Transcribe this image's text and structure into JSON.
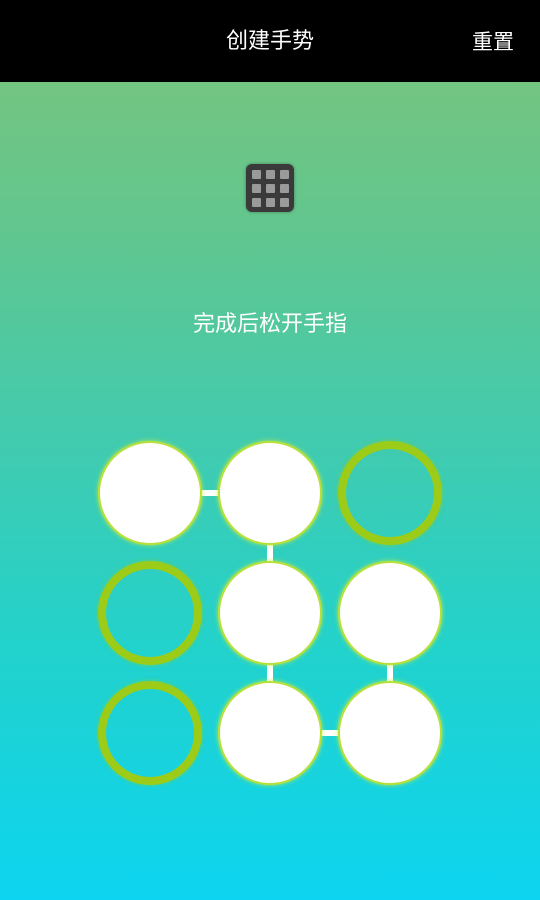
{
  "header": {
    "title": "创建手势",
    "reset_label": "重置",
    "background": "#000000"
  },
  "preview": {
    "icon": "grid-preview-icon",
    "dot_color": "#9a9a9a"
  },
  "hint": "完成后松开手指",
  "pattern": {
    "rows": 3,
    "cols": 3,
    "selected_nodes": [
      1,
      2,
      5,
      8,
      6,
      9
    ],
    "node_states": [
      [
        true,
        true,
        false
      ],
      [
        false,
        true,
        true
      ],
      [
        false,
        true,
        true
      ]
    ],
    "selected_color": "#ffffff",
    "unselected_ring_color": "#9ccc17"
  }
}
